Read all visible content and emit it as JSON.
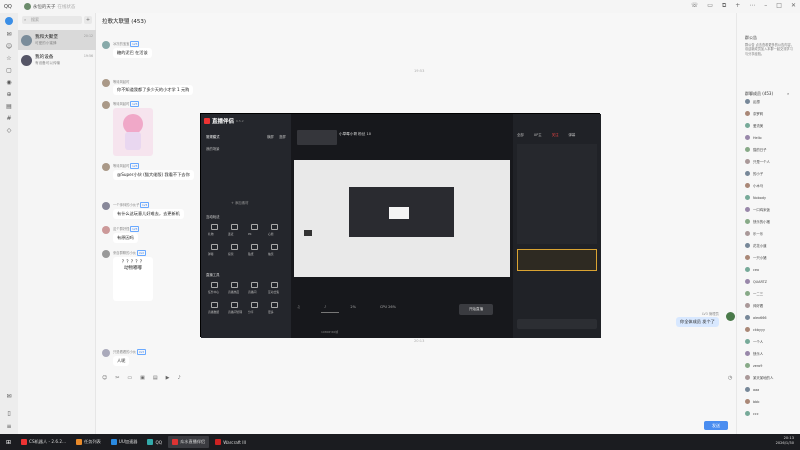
{
  "titlebar": {
    "app": "QQ",
    "account": "永恒的天子",
    "status": "在线状态"
  },
  "search": {
    "placeholder": "搜索"
  },
  "conversations": [
    {
      "title": "我和大聚堡",
      "preview": "可爱的小蜜蜂",
      "time": "20:12"
    },
    {
      "title": "我的设备",
      "preview": "有设备可以传输",
      "time": "19:56"
    }
  ],
  "chat": {
    "title": "拉歌大联盟 (453)",
    "messages": [
      {
        "name": "冰冻的宝宝",
        "badge": "LV3 ",
        "text": "糖的泥巴 在活该"
      },
      {
        "name": "等待风起时",
        "badge": "",
        "text": "你不知道我都了多少天的小才学 1 元购"
      },
      {
        "name": "等待风起时",
        "badge": "LV3 ",
        "text": ""
      },
      {
        "name": "等待风起时",
        "badge": "LV3 ",
        "text": "@Super小伙 (猫大佬版) 我看不下去你"
      },
      {
        "name": "一个帅帅的小伙子",
        "badge": "LV3 ",
        "text": "有什么这玩意儿好难去，去更新机"
      },
      {
        "name": "这个群好怪",
        "badge": "LV3 ",
        "text": "有原因吗"
      },
      {
        "name": "来自群聊的小伙",
        "badge": "LV2 ",
        "text": ""
      },
      {
        "name": "只是看看的小伙",
        "badge": "LV3 ",
        "text": "人呢"
      }
    ],
    "time1": "19:53",
    "time2": "20:13",
    "mine": {
      "name": "LV3 管理员",
      "text": "你全体成员 发个了"
    },
    "send": "发送"
  },
  "sticker_text": "？？？？？\n动物嘟嘟",
  "right": {
    "notice_title": "群公告",
    "notice_text": "群公告 点击查看更多的公告内容，欢迎新成员加入本群一起交流学习与分享经验。",
    "members_title": "群聊成员 (453)",
    "members": [
      "乱想",
      "奈罗莉",
      "爱流美",
      "Hello",
      "猫的日子",
      "只是一个人",
      "的小子",
      "小木马",
      "Nobody",
      "一口鸡米饭",
      "快乐的小猪",
      "乐一乐",
      "花花小道",
      "一只小猪",
      "ceo",
      "QUARTZ",
      "一二三",
      "帅好看",
      "alex666",
      "ckbyyy",
      "一个人",
      "快乐人",
      "zero9",
      "某天某地的人",
      "aaa",
      "bbb",
      "ccc"
    ]
  },
  "screenshot": {
    "title": "直播伴侣",
    "version": "6.5.2",
    "left_tabs": [
      "常规模式",
      "横屏",
      "竖屏"
    ],
    "scene": "我的场景",
    "add_material": "+ 添加素材",
    "interact_title": "互动玩法",
    "interact_items": [
      "礼物",
      "连麦",
      "PK",
      "心愿",
      "弹幕",
      "投票",
      "贴纸",
      "抽奖"
    ],
    "tools_title": "直播工具",
    "tool_items": [
      "任务中心",
      "直播热度",
      "直播间",
      "互动合集",
      "直播数据",
      "直播间管理",
      "分享",
      "更多"
    ],
    "streamer": "小草莓小哥 粉丝 10",
    "right_tabs": [
      "全部",
      "UP主",
      "关注",
      "弹幕"
    ],
    "start_btn": "开始直播",
    "resolution": "1080P 60帧",
    "bitrate": "2%",
    "cpu": "CPU 26%"
  },
  "taskbar": [
    {
      "label": "CS机器人 - 2.6.2...",
      "color": "#e33"
    },
    {
      "label": "任务列表",
      "color": "#e88a2a"
    },
    {
      "label": "UU加速器",
      "color": "#2a8ae0"
    },
    {
      "label": "QQ",
      "color": "#3aa"
    },
    {
      "label": "众水直播伴侣",
      "color": "#d33"
    },
    {
      "label": "Warcraft III",
      "color": "#c22"
    }
  ],
  "tray": {
    "time": "20:13",
    "date": "2026/1/30"
  }
}
